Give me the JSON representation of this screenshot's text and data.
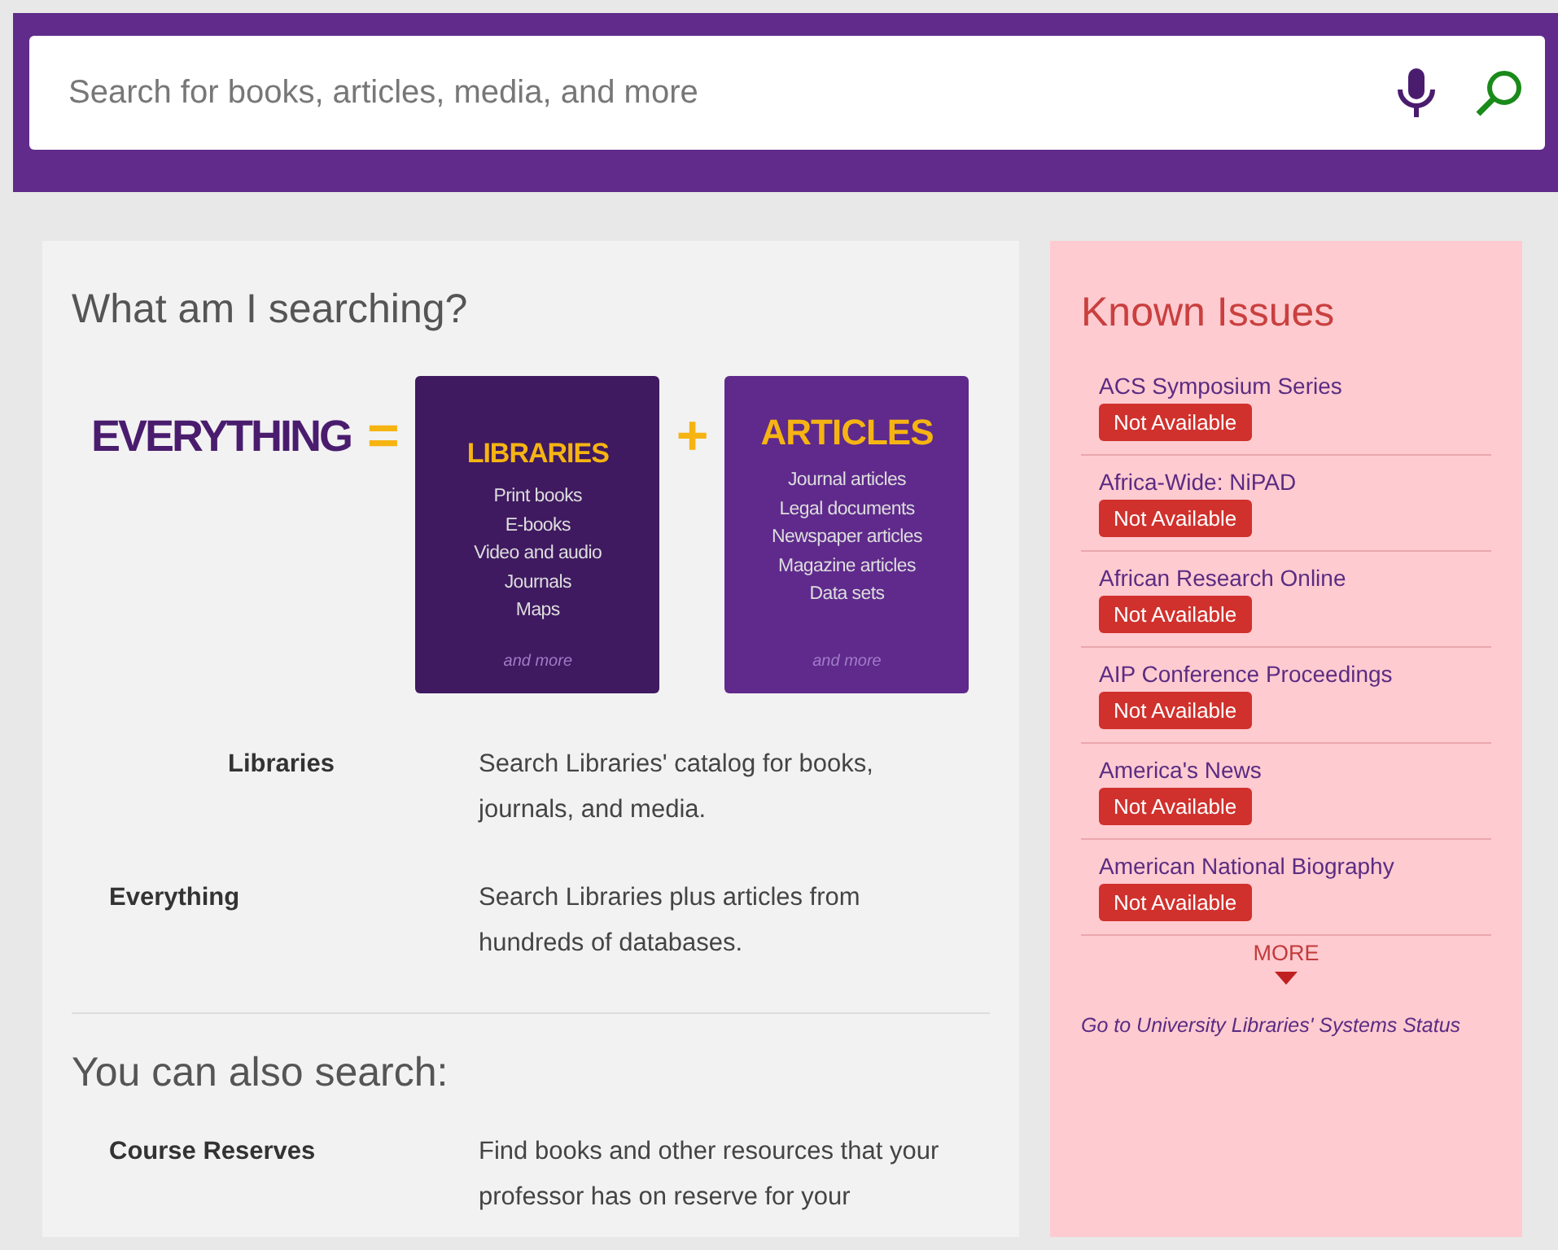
{
  "search": {
    "placeholder": "Search for books, articles, media, and more"
  },
  "main": {
    "title": "What am I searching?",
    "infographic": {
      "word": "EVERYTHING",
      "equals": "=",
      "plus": "+",
      "boxes": [
        {
          "title": "LIBRARIES",
          "items": [
            "Print books",
            "E-books",
            "Video and audio",
            "Journals",
            "Maps"
          ],
          "more": "and more",
          "color": "#3f1a60"
        },
        {
          "title": "ARTICLES",
          "items": [
            "Journal articles",
            "Legal documents",
            "Newspaper articles",
            "Magazine articles",
            "Data sets"
          ],
          "more": "and more",
          "color": "#5f2a8c"
        }
      ]
    },
    "definitions": [
      {
        "term": "Libraries",
        "indent": true,
        "description": "Search Libraries' catalog for books, journals, and media."
      },
      {
        "term": "Everything",
        "indent": false,
        "description": "Search Libraries plus articles from hundreds of databases."
      }
    ],
    "also_title": "You can also search:",
    "also": [
      {
        "term": "Course Reserves",
        "description": "Find books and other resources that your professor has on reserve for your"
      }
    ]
  },
  "issues": {
    "title": "Known Issues",
    "items": [
      {
        "name": "ACS Symposium Series",
        "status": "Not Available"
      },
      {
        "name": "Africa-Wide: NiPAD",
        "status": "Not Available"
      },
      {
        "name": "African Research Online",
        "status": "Not Available"
      },
      {
        "name": "AIP Conference Proceedings",
        "status": "Not Available"
      },
      {
        "name": "America's News",
        "status": "Not Available"
      },
      {
        "name": "American National Biography",
        "status": "Not Available"
      }
    ],
    "more": "MORE",
    "footer_link": "Go to University Libraries' Systems Status"
  }
}
